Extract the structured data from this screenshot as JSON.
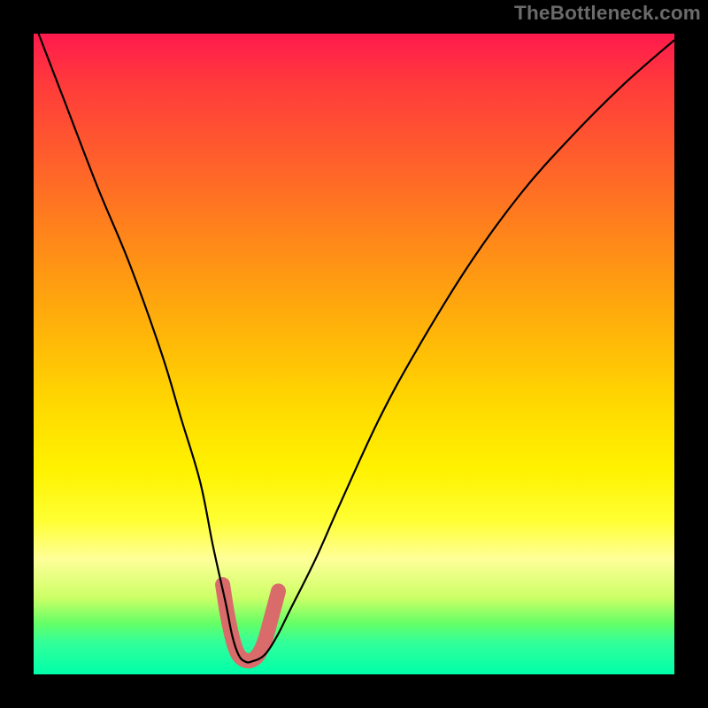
{
  "watermark": "TheBottleneck.com",
  "chart_data": {
    "type": "line",
    "title": "",
    "xlabel": "",
    "ylabel": "",
    "x_range": [
      0,
      100
    ],
    "y_range": [
      0,
      100
    ],
    "series": [
      {
        "name": "bottleneck-curve",
        "x": [
          0,
          5,
          10,
          15,
          20,
          23,
          26,
          28,
          30,
          31,
          32,
          33,
          34,
          36,
          38,
          40,
          44,
          48,
          54,
          60,
          68,
          76,
          84,
          92,
          100
        ],
        "values": [
          102,
          89,
          76,
          64,
          50,
          40,
          30,
          20,
          11,
          6,
          3,
          2,
          2,
          3,
          6,
          10,
          18,
          27,
          40,
          51,
          64,
          75,
          84,
          92,
          99
        ]
      },
      {
        "name": "optimal-zone-marker",
        "x": [
          29.5,
          30.3,
          31.2,
          32.0,
          33.0,
          34.0,
          35.0,
          36.0,
          37.0,
          38.2
        ],
        "values": [
          14.0,
          9.0,
          5.0,
          3.0,
          2.2,
          2.2,
          3.0,
          5.0,
          8.5,
          13.0
        ]
      }
    ],
    "gradient_meaning": "vertical axis encodes bottleneck severity: top (red) = severe, bottom (green) = optimal",
    "grid": false,
    "legend": false
  }
}
